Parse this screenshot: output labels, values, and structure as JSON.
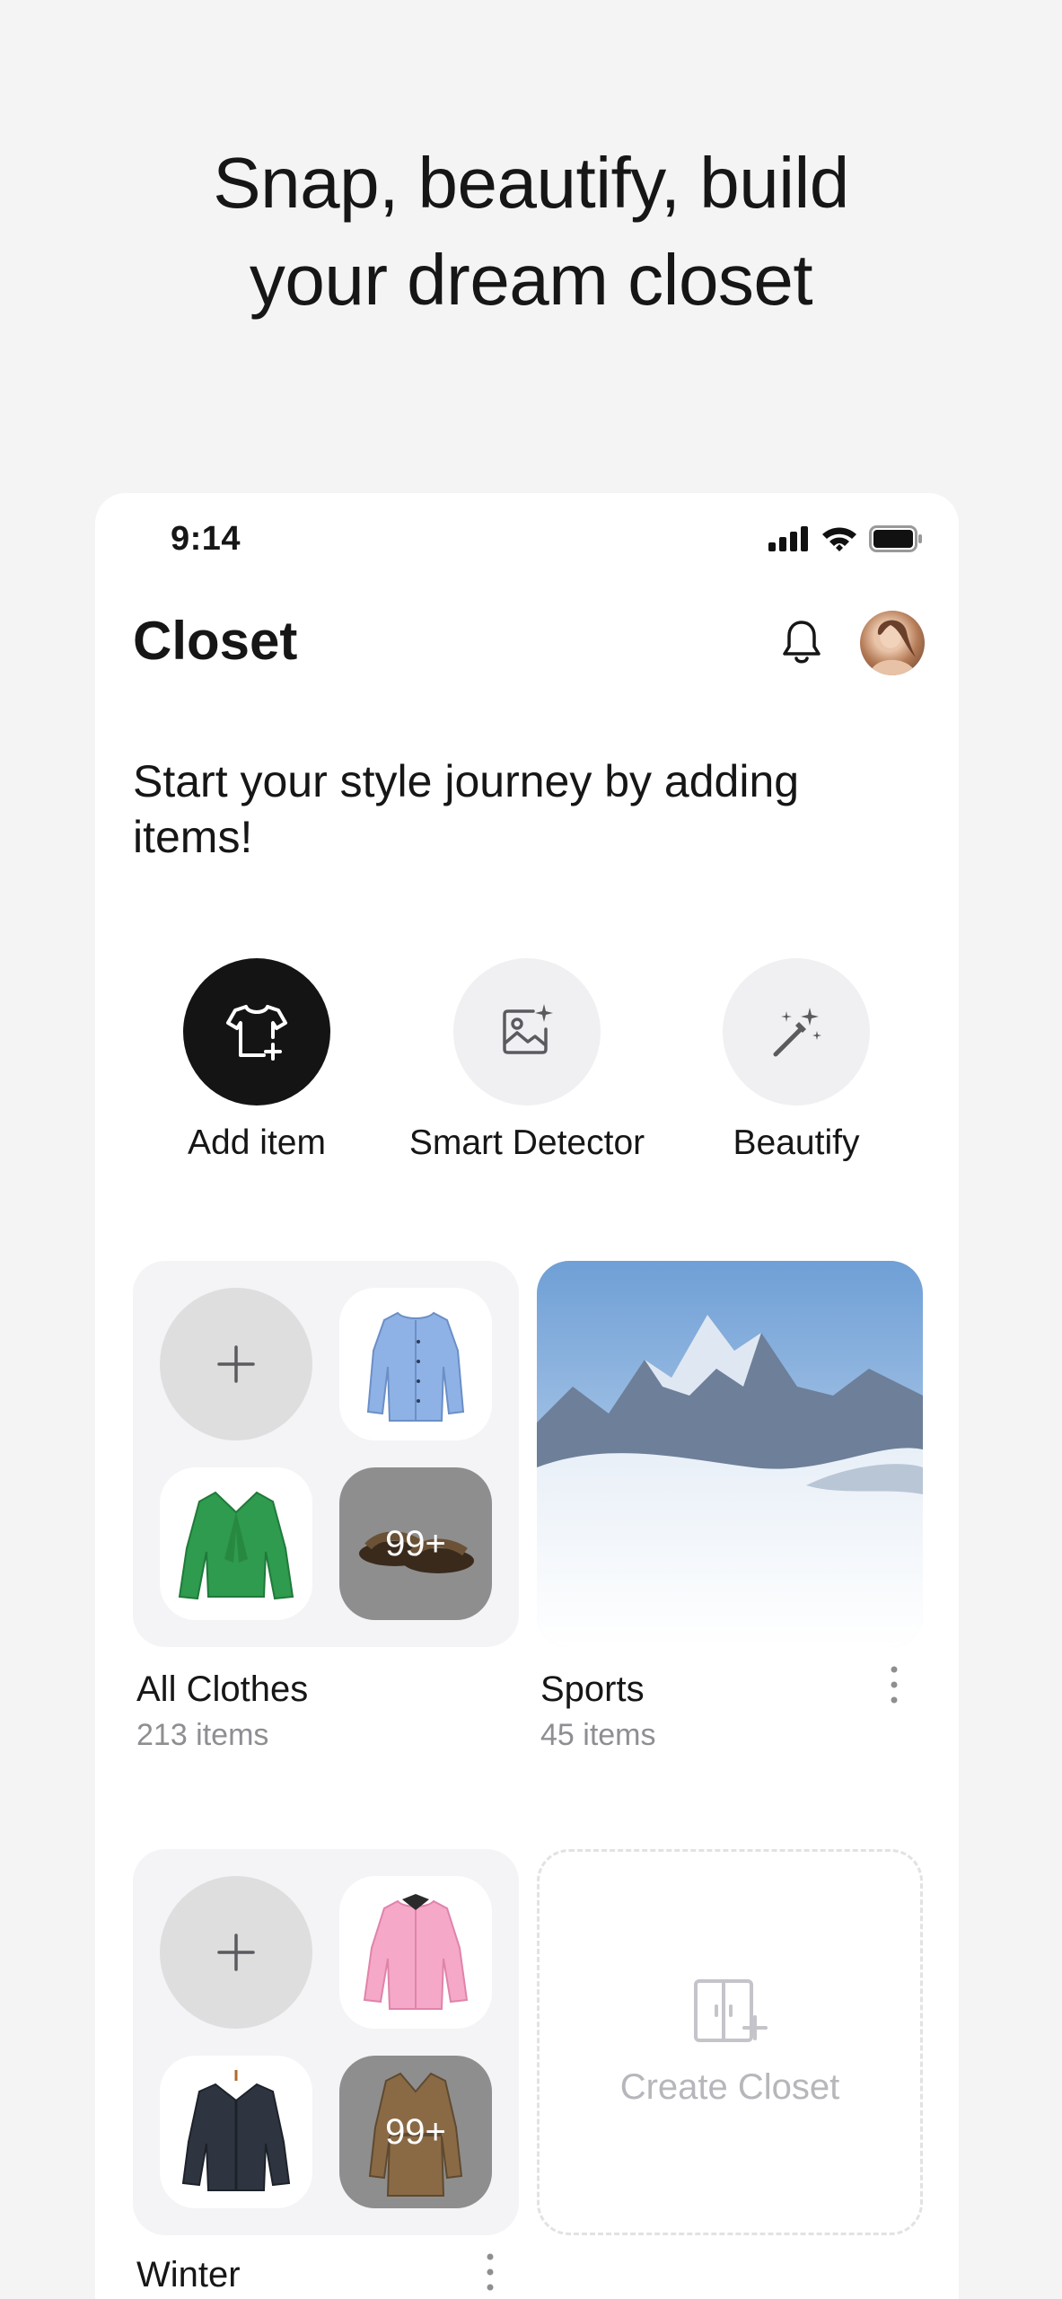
{
  "headline": {
    "line1": "Snap, beautify, build",
    "line2": "your dream closet"
  },
  "status_bar": {
    "time": "9:14",
    "icons": [
      "signal-icon",
      "wifi-icon",
      "battery-icon"
    ]
  },
  "header": {
    "title": "Closet",
    "icons": [
      "bell-icon",
      "avatar"
    ]
  },
  "intro": "Start your style journey by adding items!",
  "actions": [
    {
      "label": "Add item",
      "icon": "tshirt-plus-icon"
    },
    {
      "label": "Smart Detector",
      "icon": "image-sparkle-icon"
    },
    {
      "label": "Beautify",
      "icon": "magic-wand-icon"
    }
  ],
  "closets": [
    {
      "name": "All Clothes",
      "count": "213 items",
      "more": "99+"
    },
    {
      "name": "Sports",
      "count": "45 items"
    },
    {
      "name": "Winter",
      "more": "99+"
    }
  ],
  "create_closet": {
    "label": "Create Closet"
  },
  "colors": {
    "background": "#f4f4f4",
    "card": "#ffffff",
    "dark_button": "#141414",
    "muted_text": "#8e8e93"
  }
}
